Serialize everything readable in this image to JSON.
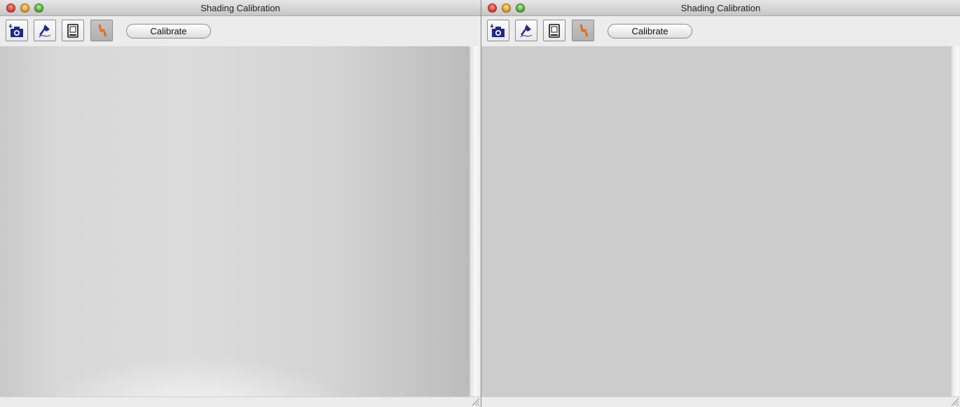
{
  "windows": [
    {
      "title": "Shading Calibration",
      "toolbar": {
        "buttons": [
          {
            "icon": "camera-capture-icon"
          },
          {
            "icon": "pen-tool-icon"
          },
          {
            "icon": "monitor-icon"
          },
          {
            "icon": "calibration-tool-icon",
            "active": true
          }
        ],
        "calibrate_label": "Calibrate"
      },
      "image": {
        "state": "uncorrected shading"
      }
    },
    {
      "title": "Shading Calibration",
      "toolbar": {
        "buttons": [
          {
            "icon": "camera-capture-icon"
          },
          {
            "icon": "pen-tool-icon"
          },
          {
            "icon": "monitor-icon"
          },
          {
            "icon": "calibration-tool-icon",
            "active": true
          }
        ],
        "calibrate_label": "Calibrate"
      },
      "image": {
        "state": "flat corrected"
      }
    }
  ],
  "colors": {
    "icon_blue": "#1e2a8a",
    "icon_orange": "#e86a1a",
    "corrected_gray": "#cccccc"
  }
}
